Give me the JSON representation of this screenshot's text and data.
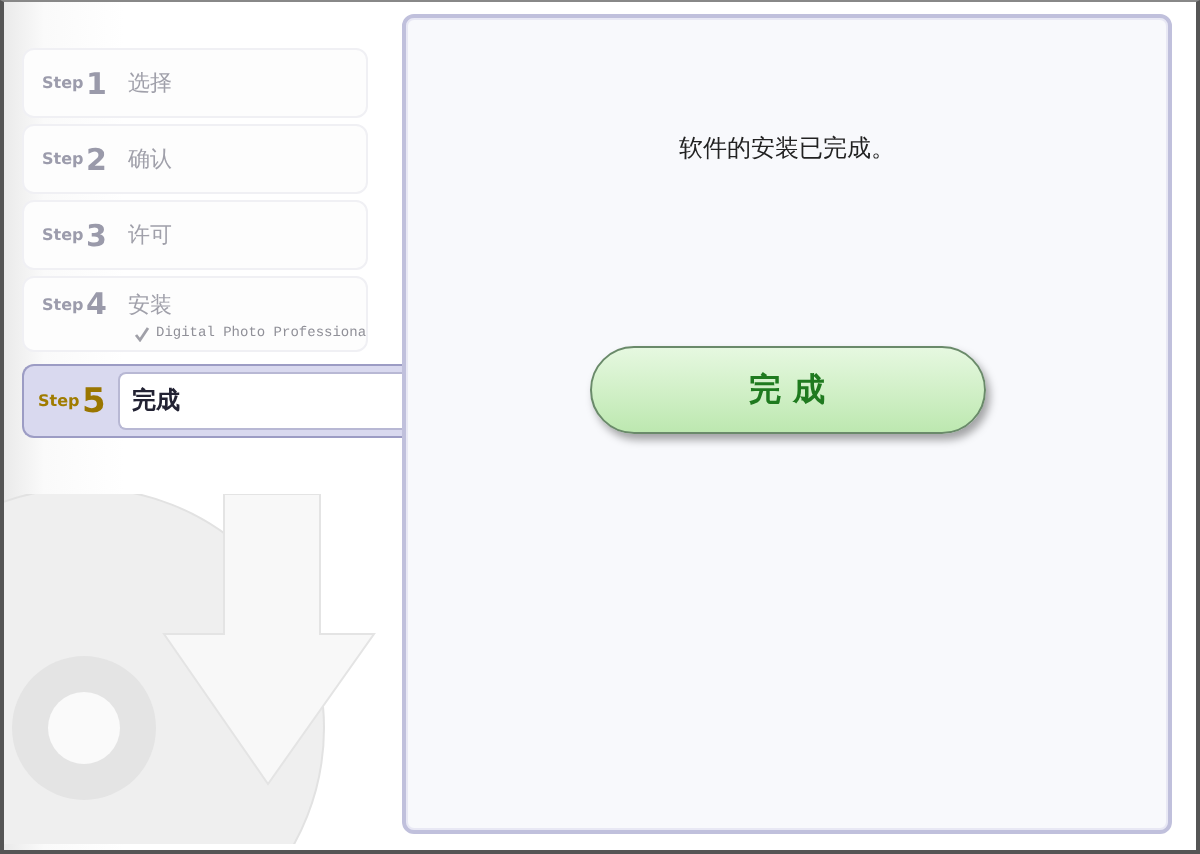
{
  "steps": [
    {
      "prefix": "Step",
      "number": "1",
      "label": "选择",
      "selected": false
    },
    {
      "prefix": "Step",
      "number": "2",
      "label": "确认",
      "selected": false
    },
    {
      "prefix": "Step",
      "number": "3",
      "label": "许可",
      "selected": false
    },
    {
      "prefix": "Step",
      "number": "4",
      "label": "安装",
      "selected": false,
      "items": [
        {
          "label": "Digital Photo Professiona",
          "checked": true
        }
      ]
    },
    {
      "prefix": "Step",
      "number": "5",
      "label": "完成",
      "selected": true
    }
  ],
  "main": {
    "message": "软件的安装已完成。",
    "finish_button": "完 成"
  }
}
